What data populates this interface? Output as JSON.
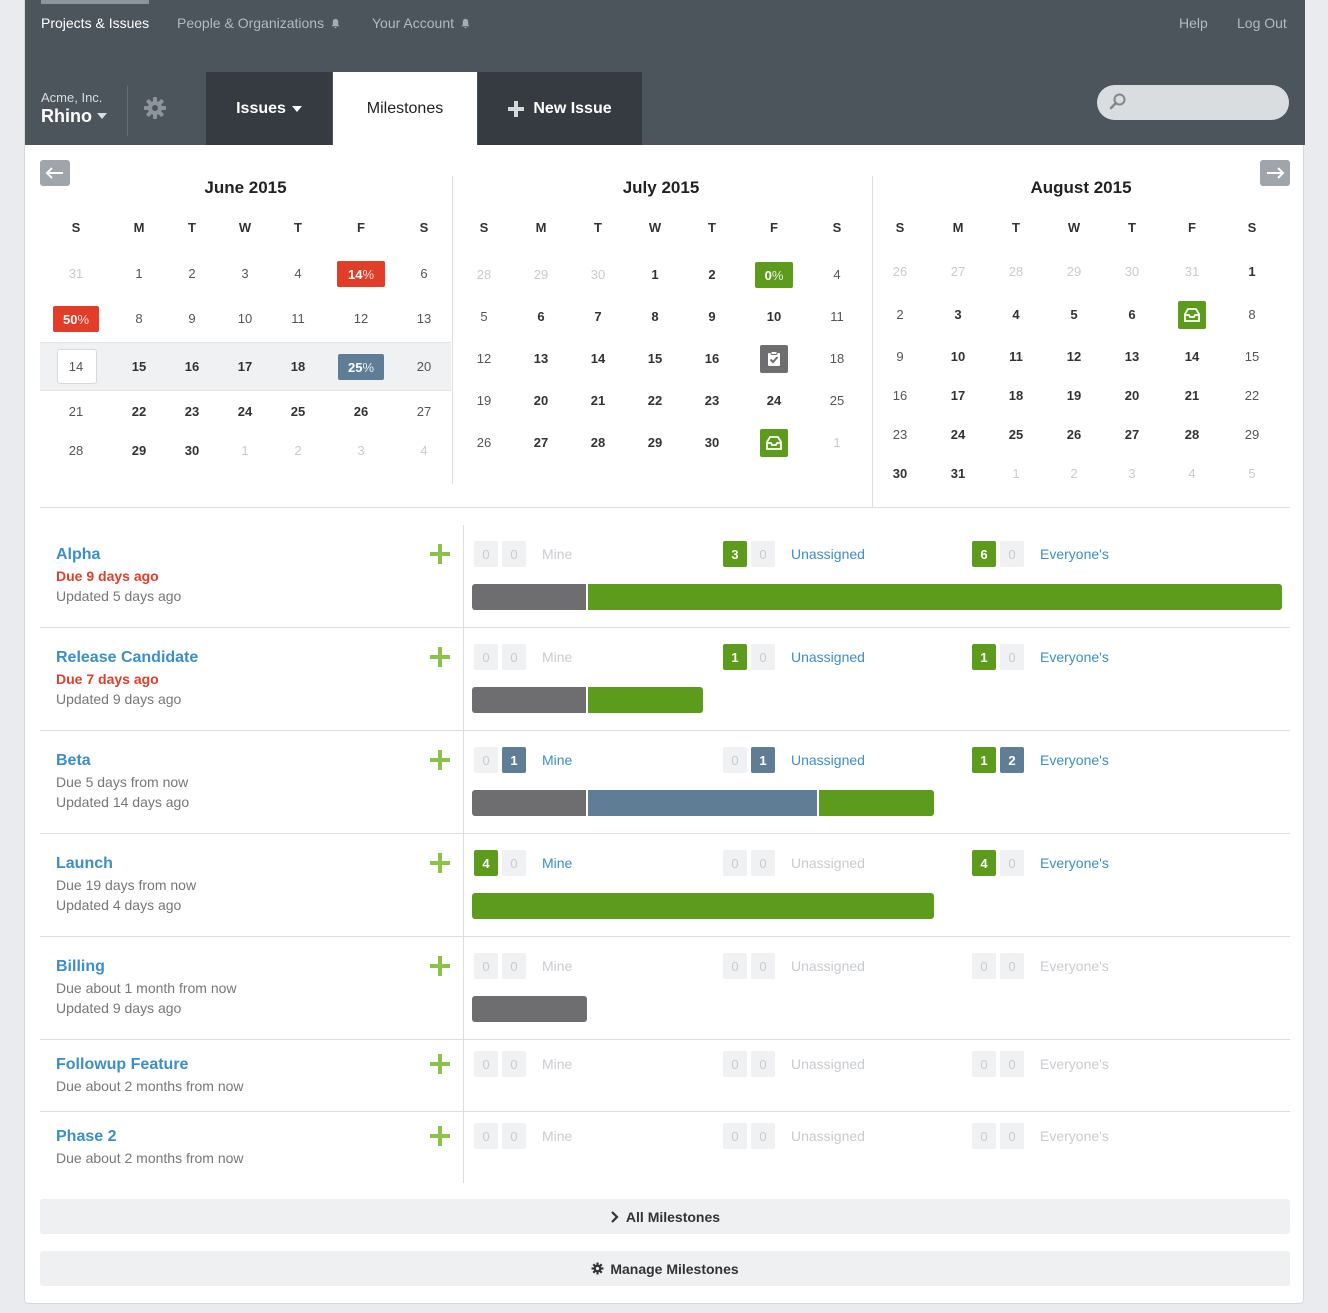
{
  "nav": {
    "projects_issues": "Projects & Issues",
    "people_orgs": "People & Organizations",
    "your_account": "Your Account",
    "help": "Help",
    "logout": "Log Out"
  },
  "org": {
    "name": "Acme, Inc.",
    "project": "Rhino"
  },
  "tabs": {
    "issues": "Issues",
    "milestones": "Milestones",
    "new_issue": "New Issue"
  },
  "search": {
    "placeholder": ""
  },
  "calendars": [
    {
      "title": "June 2015",
      "weekdays": [
        "S",
        "M",
        "T",
        "W",
        "T",
        "F",
        "S"
      ],
      "weeks": [
        [
          "31",
          "1",
          "2",
          "3",
          "4",
          "14%",
          "6"
        ],
        [
          "50%",
          "8",
          "9",
          "10",
          "11",
          "12",
          "13"
        ],
        [
          "14",
          "15",
          "16",
          "17",
          "18",
          "25%",
          "20"
        ],
        [
          "21",
          "22",
          "23",
          "24",
          "25",
          "26",
          "27"
        ],
        [
          "28",
          "29",
          "30",
          "1",
          "2",
          "3",
          "4"
        ]
      ]
    },
    {
      "title": "July 2015",
      "weekdays": [
        "S",
        "M",
        "T",
        "W",
        "T",
        "F",
        "S"
      ],
      "weeks": [
        [
          "28",
          "29",
          "30",
          "1",
          "2",
          "0%",
          "4"
        ],
        [
          "5",
          "6",
          "7",
          "8",
          "9",
          "10",
          "11"
        ],
        [
          "12",
          "13",
          "14",
          "15",
          "16",
          "",
          "18"
        ],
        [
          "19",
          "20",
          "21",
          "22",
          "23",
          "24",
          "25"
        ],
        [
          "26",
          "27",
          "28",
          "29",
          "30",
          "",
          "1"
        ]
      ]
    },
    {
      "title": "August 2015",
      "weekdays": [
        "S",
        "M",
        "T",
        "W",
        "T",
        "F",
        "S"
      ],
      "weeks": [
        [
          "26",
          "27",
          "28",
          "29",
          "30",
          "31",
          "1"
        ],
        [
          "2",
          "3",
          "4",
          "5",
          "6",
          "",
          "8"
        ],
        [
          "9",
          "10",
          "11",
          "12",
          "13",
          "14",
          "15"
        ],
        [
          "16",
          "17",
          "18",
          "19",
          "20",
          "21",
          "22"
        ],
        [
          "23",
          "24",
          "25",
          "26",
          "27",
          "28",
          "29"
        ],
        [
          "30",
          "31",
          "1",
          "2",
          "3",
          "4",
          "5"
        ]
      ]
    }
  ],
  "labels": {
    "mine": "Mine",
    "unassigned": "Unassigned",
    "everyone": "Everyone's"
  },
  "milestones": [
    {
      "title": "Alpha",
      "due": "Due 9 days ago",
      "updated": "Updated 5 days ago",
      "mine": [
        "0",
        "0"
      ],
      "unassigned": [
        "3",
        "0"
      ],
      "everyone": [
        "6",
        "0"
      ]
    },
    {
      "title": "Release Candidate",
      "due": "Due 7 days ago",
      "updated": "Updated 9 days ago",
      "mine": [
        "0",
        "0"
      ],
      "unassigned": [
        "1",
        "0"
      ],
      "everyone": [
        "1",
        "0"
      ]
    },
    {
      "title": "Beta",
      "due": "Due 5 days from now",
      "updated": "Updated 14 days ago",
      "mine": [
        "0",
        "1"
      ],
      "unassigned": [
        "0",
        "1"
      ],
      "everyone": [
        "1",
        "2"
      ]
    },
    {
      "title": "Launch",
      "due": "Due 19 days from now",
      "updated": "Updated 4 days ago",
      "mine": [
        "4",
        "0"
      ],
      "unassigned": [
        "0",
        "0"
      ],
      "everyone": [
        "4",
        "0"
      ]
    },
    {
      "title": "Billing",
      "due": "Due about 1 month from now",
      "updated": "Updated 9 days ago",
      "mine": [
        "0",
        "0"
      ],
      "unassigned": [
        "0",
        "0"
      ],
      "everyone": [
        "0",
        "0"
      ]
    },
    {
      "title": "Followup Feature",
      "due": "Due about 2 months from now",
      "updated": "",
      "mine": [
        "0",
        "0"
      ],
      "unassigned": [
        "0",
        "0"
      ],
      "everyone": [
        "0",
        "0"
      ]
    },
    {
      "title": "Phase 2",
      "due": "Due about 2 months from now",
      "updated": "",
      "mine": [
        "0",
        "0"
      ],
      "unassigned": [
        "0",
        "0"
      ],
      "everyone": [
        "0",
        "0"
      ]
    }
  ],
  "buttons": {
    "all_milestones": "All Milestones",
    "manage_milestones": "Manage Milestones"
  },
  "colors": {
    "nav_bg": "#4c545c",
    "tab_dark": "#353b41",
    "link": "#3a8fcb",
    "green": "#5d9b1c",
    "red": "#e23d28",
    "blue": "#5f7e96",
    "grey": "#6e6e70"
  }
}
